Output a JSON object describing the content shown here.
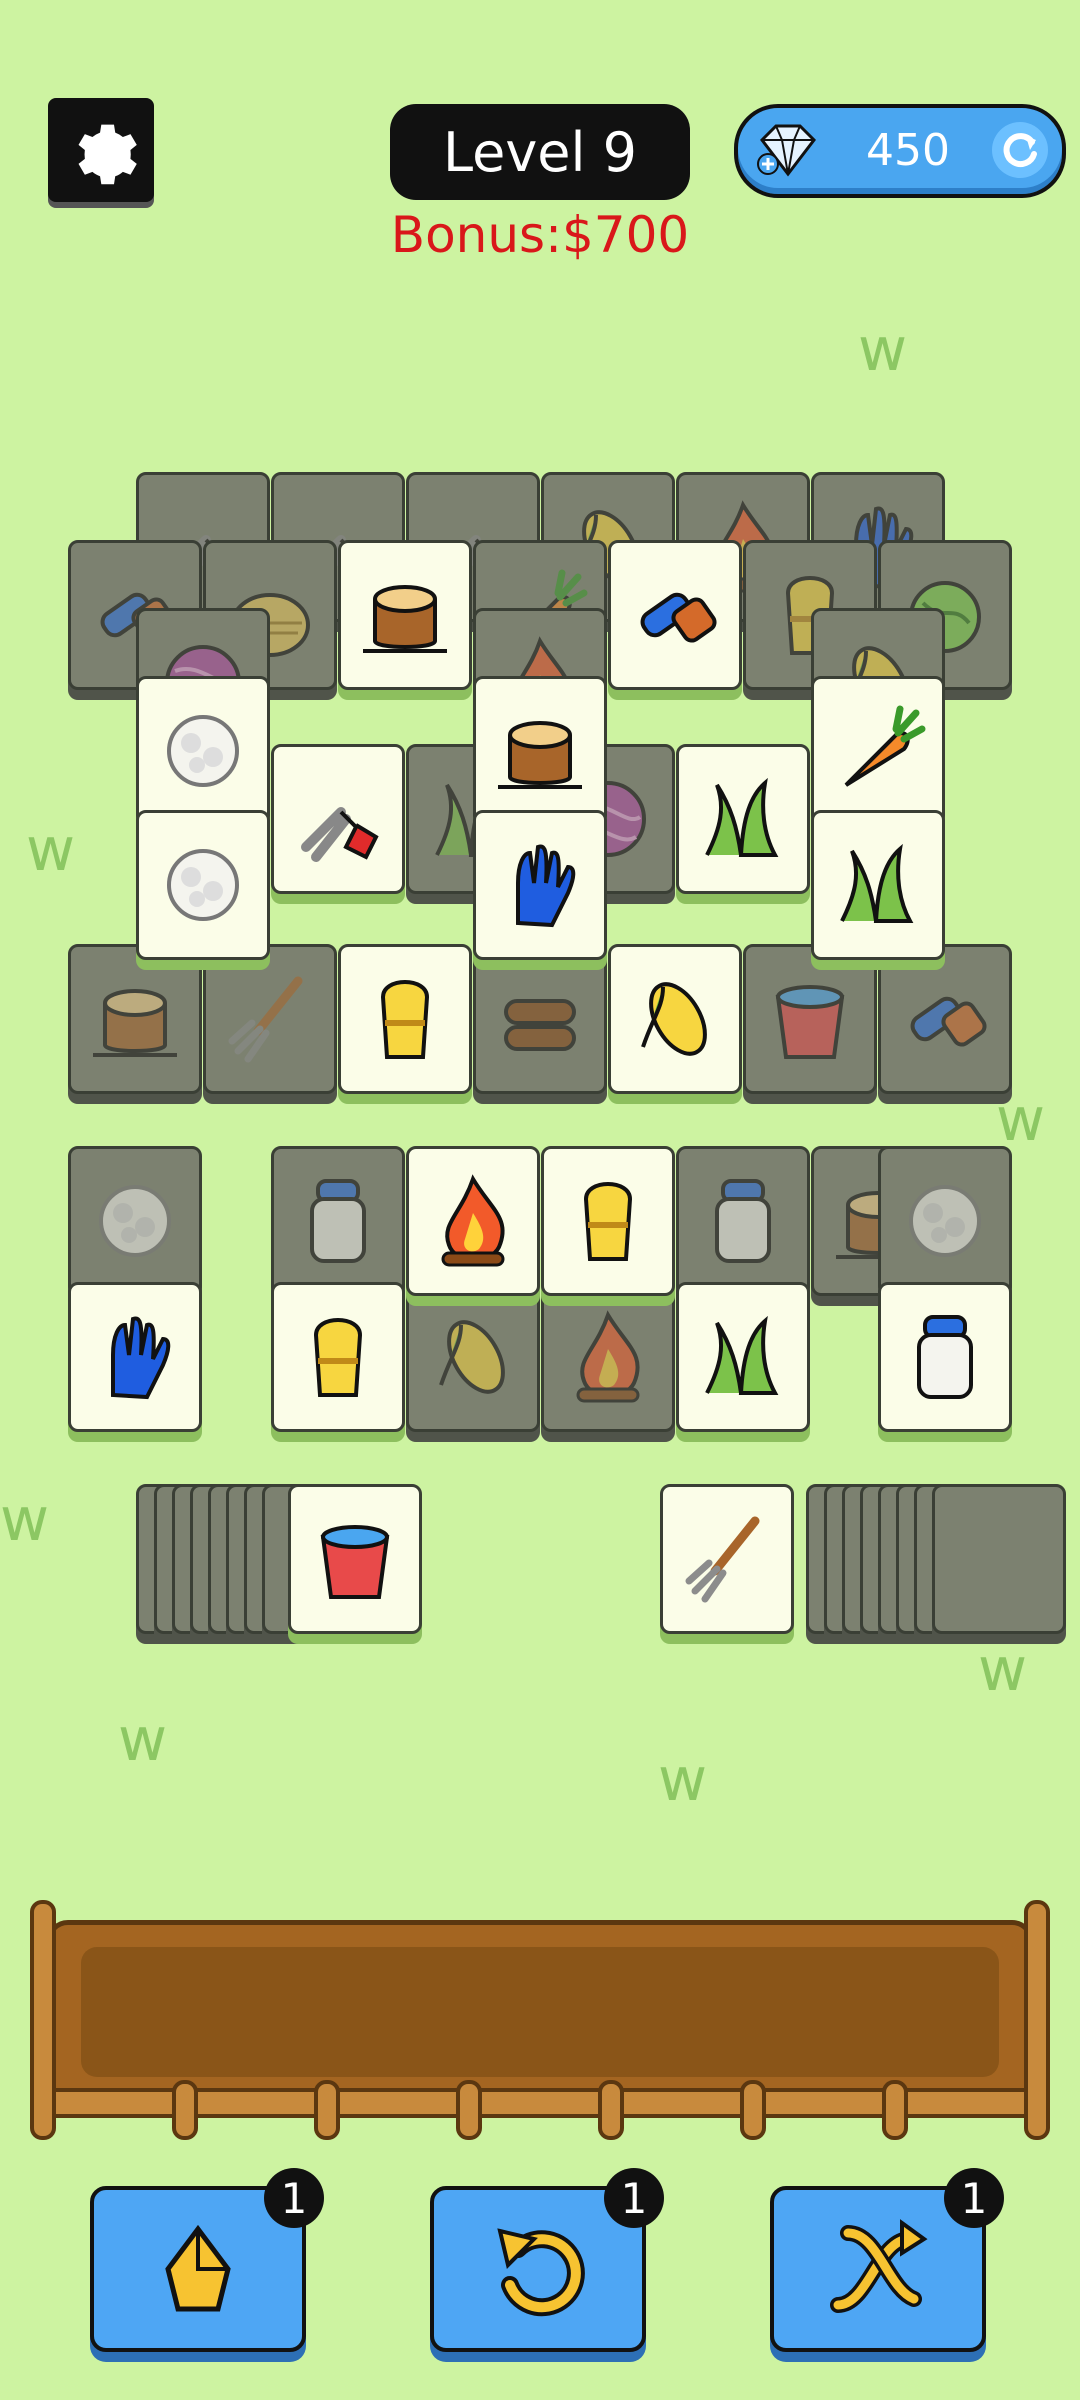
{
  "header": {
    "level_label": "Level 9",
    "bonus_label": "Bonus:$700",
    "gems_value": "450"
  },
  "powerups": [
    {
      "name": "hint",
      "count": "1"
    },
    {
      "name": "undo",
      "count": "1"
    },
    {
      "name": "shuffle",
      "count": "1"
    }
  ],
  "colors": {
    "background": "#cdf3a1",
    "tile_face": "#fbfde8",
    "tile_dim": "#7c8170",
    "button_blue": "#4ea6f4",
    "bonus_red": "#d9171a"
  },
  "tiles_layout": {
    "board": [
      "shears",
      "shears",
      "shears",
      "corn",
      "fire",
      "glove",
      "brush",
      "haystack",
      "stump",
      "carrot",
      "brush",
      "wheat",
      "cabbage",
      "yarn",
      "fire",
      "corn",
      "wool",
      "stump",
      "carrot",
      "shears",
      "grass",
      "yarn",
      "grass",
      "wool",
      "glove",
      "grass",
      "stump",
      "pitchfork",
      "wheat",
      "logs",
      "corn",
      "bucket",
      "brush",
      "wool",
      "milk",
      "fire",
      "wheat",
      "milk",
      "stump",
      "wool",
      "glove",
      "wheat",
      "corn",
      "fire",
      "grass",
      "milk"
    ],
    "left_stack_top": "bucket",
    "right_stack_top": "pitchfork"
  }
}
